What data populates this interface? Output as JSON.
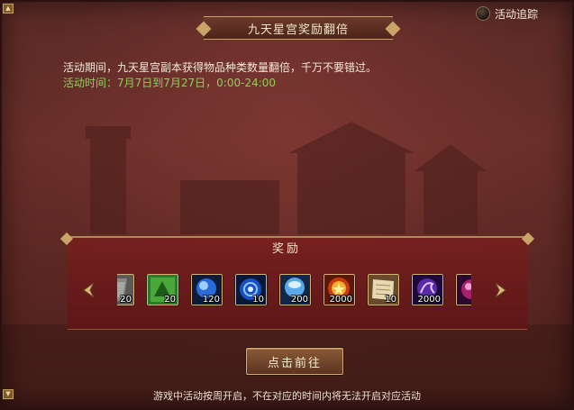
{
  "title": "九天星宫奖励翻倍",
  "track": {
    "label": "活动追踪"
  },
  "description": "活动期间，九天星宫副本获得物品种类数量翻倍，千万不要错过。",
  "time_line": "活动时间：7月7日到7月27日，0:00-24:00",
  "reward_section": {
    "title": "奖励",
    "items": [
      {
        "icon": "scroll-item-icon",
        "qty": "20"
      },
      {
        "icon": "green-crystal-icon",
        "qty": "20"
      },
      {
        "icon": "blue-orb-icon",
        "qty": "120"
      },
      {
        "icon": "blue-spiral-orb-icon",
        "qty": "10"
      },
      {
        "icon": "light-blue-orb-icon",
        "qty": "200"
      },
      {
        "icon": "gold-medal-icon",
        "qty": "2000"
      },
      {
        "icon": "parchment-scroll-icon",
        "qty": "10"
      },
      {
        "icon": "purple-dragon-icon",
        "qty": "2000"
      },
      {
        "icon": "magenta-orb-icon",
        "qty": ""
      }
    ]
  },
  "go_button": {
    "label": "点击前往"
  },
  "notice": "游戏中活动按周开启，不在对应的时间内将无法开启对应活动",
  "colors": {
    "accent_gold": "#c9a468",
    "time_green": "#8fcf5a",
    "banner_red": "#781e1e"
  }
}
